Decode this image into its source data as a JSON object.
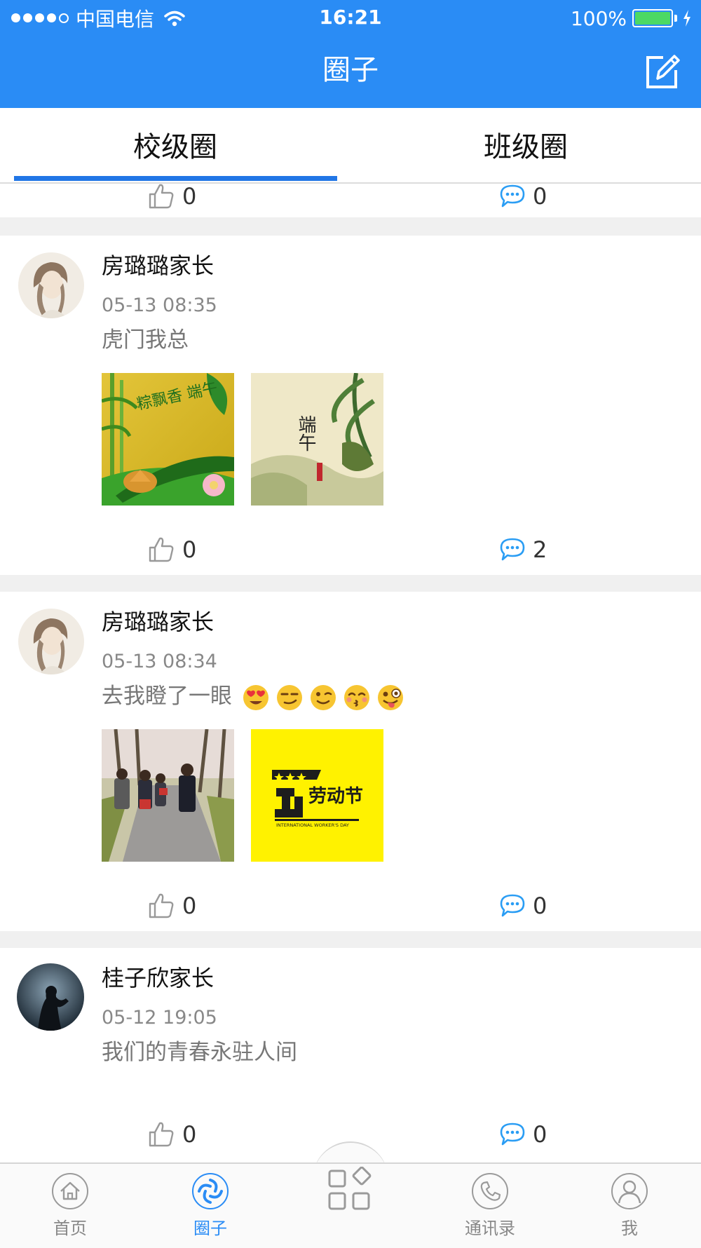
{
  "status_bar": {
    "carrier": "中国电信",
    "time": "16:21",
    "battery": "100%",
    "battery_level": 1.0
  },
  "header": {
    "title": "圈子",
    "edit_icon": "edit-icon"
  },
  "tabs": [
    {
      "label": "校级圈",
      "active": true
    },
    {
      "label": "班级圈",
      "active": false
    }
  ],
  "partial_post": {
    "likes": "0",
    "comments": "0"
  },
  "posts": [
    {
      "author": "房璐璐家长",
      "time": "05-13 08:35",
      "text": "虎门我总",
      "emojis": [],
      "likes": "0",
      "comments": "2"
    },
    {
      "author": "房璐璐家长",
      "time": "05-13 08:34",
      "text": "去我瞪了一眼",
      "emojis": [
        "heart-eyes-emoji",
        "smirk-emoji",
        "wink-emoji",
        "kissing-emoji",
        "tongue-out-emoji"
      ],
      "likes": "0",
      "comments": "0"
    },
    {
      "author": "桂子欣家长",
      "time": "05-12 19:05",
      "text": "我们的青春永驻人间",
      "emojis": [],
      "likes": "0",
      "comments": "0"
    }
  ],
  "images": {
    "post1_img1_text": "粽飘香 端午",
    "post1_img2_text": "端午",
    "post2_img2_title": "劳动节",
    "post2_img2_sub": "INTERNATIONAL WORKER'S DAY"
  },
  "bottom_nav": [
    {
      "label": "首页",
      "icon": "home-icon",
      "active": false
    },
    {
      "label": "圈子",
      "icon": "circle-icon",
      "active": true
    },
    {
      "label": "",
      "icon": "apps-grid-icon",
      "active": false
    },
    {
      "label": "通讯录",
      "icon": "phone-icon",
      "active": false
    },
    {
      "label": "我",
      "icon": "profile-icon",
      "active": false
    }
  ],
  "colors": {
    "primary": "#2a8cf5",
    "tab_underline": "#2176e6",
    "comment_icon": "#2a9df4",
    "separator": "#f0f0f0"
  }
}
